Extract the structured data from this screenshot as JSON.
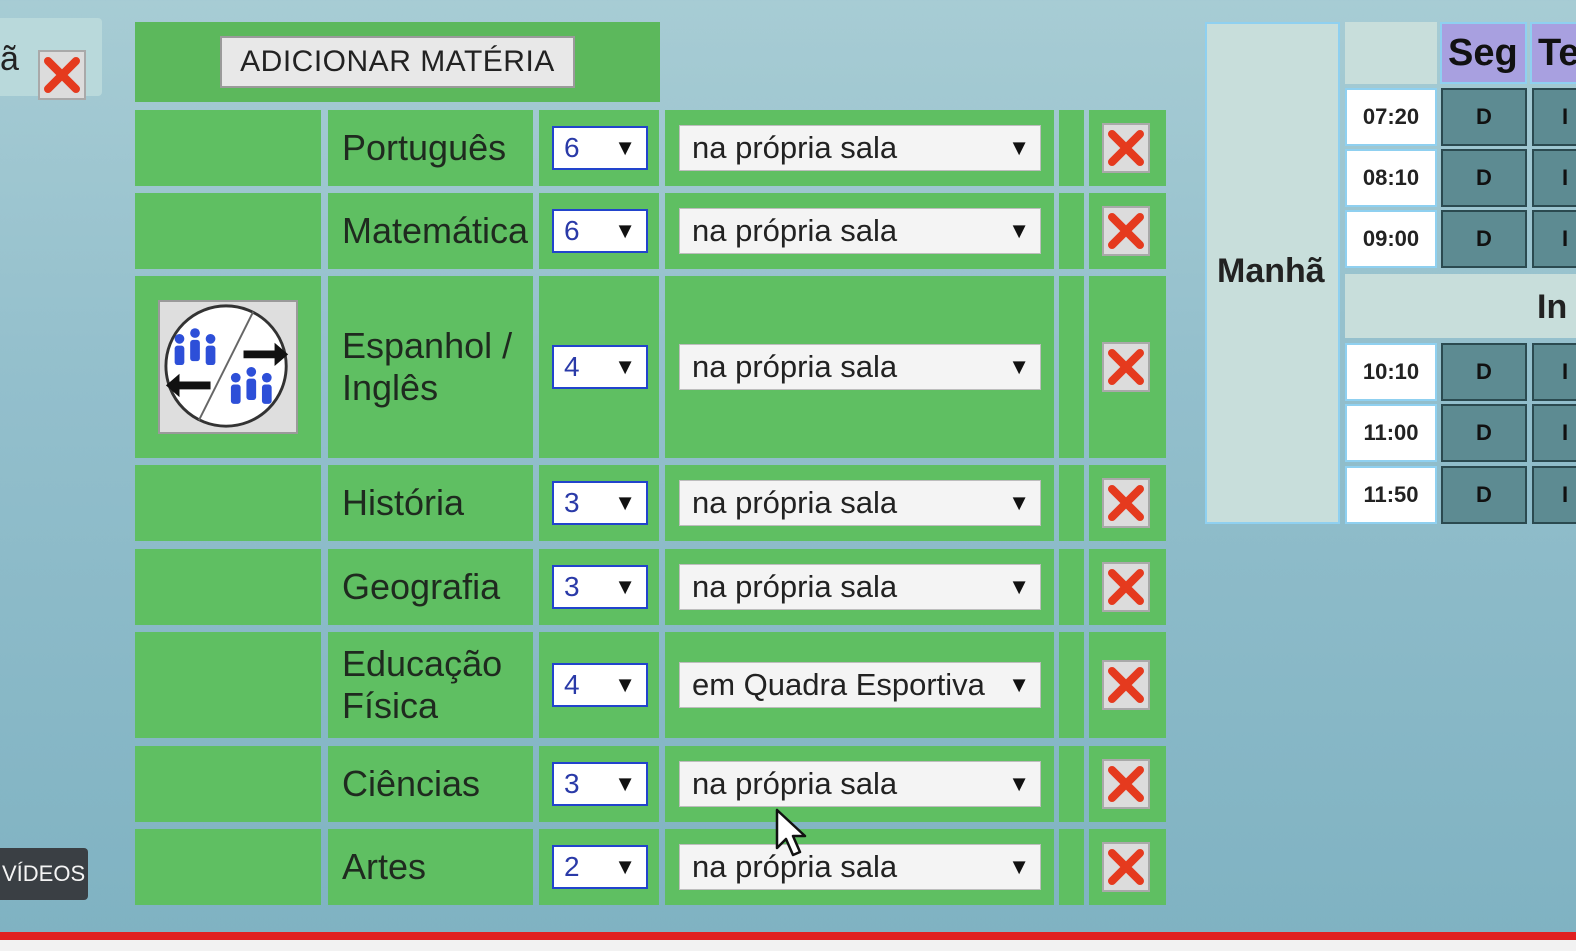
{
  "left_tab": {
    "fragment": "ã"
  },
  "toolbar": {
    "add_subject_label": "ADICIONAR MATÉRIA"
  },
  "subjects": [
    {
      "name": "Português",
      "classes": "6",
      "location": "na própria sala"
    },
    {
      "name": "Matemática",
      "classes": "6",
      "location": "na própria sala"
    },
    {
      "name": "Espanhol /\nInglês",
      "classes": "4",
      "location": "na própria sala"
    },
    {
      "name": "História",
      "classes": "3",
      "location": "na própria sala"
    },
    {
      "name": "Geografia",
      "classes": "3",
      "location": "na própria sala"
    },
    {
      "name": "Educação\nFísica",
      "classes": "4",
      "location": "em Quadra Esportiva"
    },
    {
      "name": "Ciências",
      "classes": "3",
      "location": "na própria sala"
    },
    {
      "name": "Artes",
      "classes": "2",
      "location": "na própria sala"
    }
  ],
  "select_arrow": "▼",
  "schedule": {
    "shift": "Manhã",
    "days": [
      "Seg",
      "Te"
    ],
    "interval_label": "In",
    "times": [
      "07:20",
      "08:10",
      "09:00",
      "10:10",
      "11:00",
      "11:50"
    ],
    "cell_value": "D",
    "cell_value_partial": "I"
  },
  "overlay": {
    "videos_label": "VÍDEOS"
  },
  "colors": {
    "panel_green": "#5cb85c",
    "cell_green": "#5fbf62",
    "day_header": "#a8a0e0",
    "slot_cell": "#5d8b92",
    "delete_red": "#e53a1e"
  }
}
